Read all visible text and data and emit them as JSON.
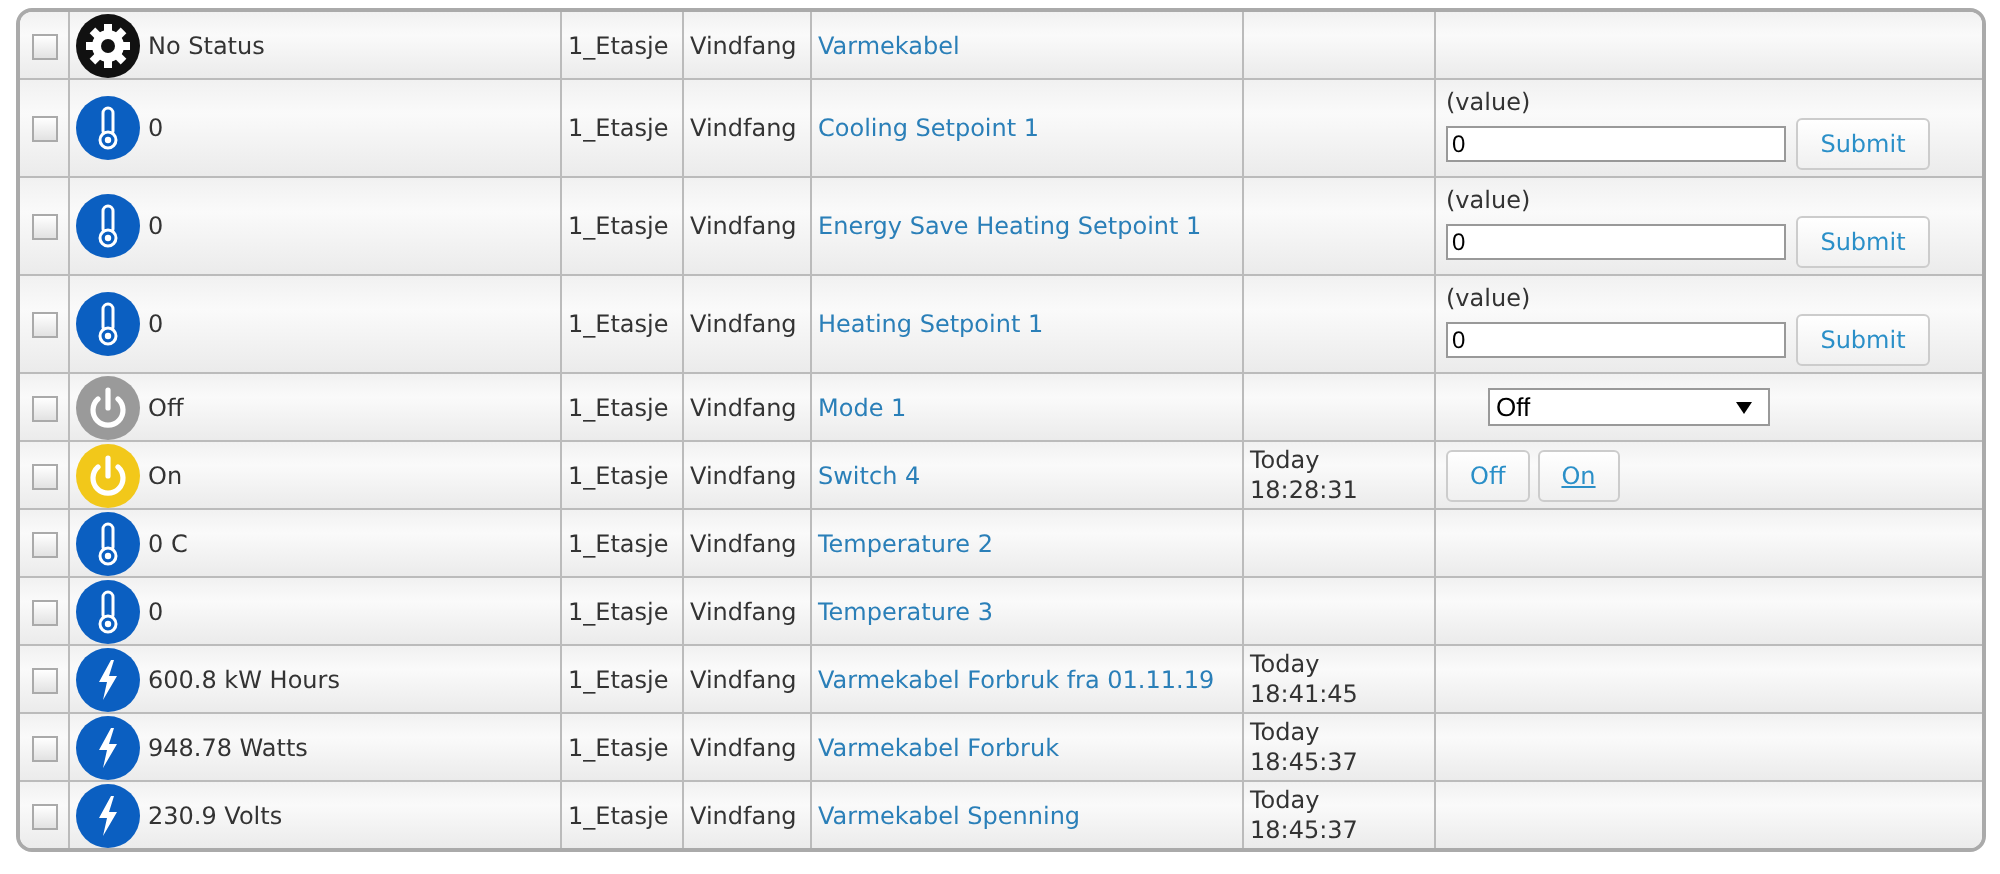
{
  "rows": [
    {
      "checked": false,
      "kind": "gear",
      "status": "No Status",
      "floor": "1_Etasje",
      "room": "Vindfang",
      "name": "Varmekabel",
      "time": [],
      "control": {
        "kind": "none"
      }
    },
    {
      "checked": false,
      "kind": "thermometer",
      "status": "0",
      "floor": "1_Etasje",
      "room": "Vindfang",
      "name": "Cooling Setpoint 1",
      "time": [],
      "control": {
        "kind": "setpoint",
        "label": "(value)",
        "value": "0",
        "button": "Submit"
      }
    },
    {
      "checked": false,
      "kind": "thermometer",
      "status": "0",
      "floor": "1_Etasje",
      "room": "Vindfang",
      "name": "Energy Save Heating Setpoint 1",
      "time": [],
      "control": {
        "kind": "setpoint",
        "label": "(value)",
        "value": "0",
        "button": "Submit"
      }
    },
    {
      "checked": false,
      "kind": "thermometer",
      "status": "0",
      "floor": "1_Etasje",
      "room": "Vindfang",
      "name": "Heating Setpoint 1",
      "time": [],
      "control": {
        "kind": "setpoint",
        "label": "(value)",
        "value": "0",
        "button": "Submit"
      }
    },
    {
      "checked": false,
      "kind": "power",
      "on": false,
      "status": "Off",
      "floor": "1_Etasje",
      "room": "Vindfang",
      "name": "Mode 1",
      "time": [],
      "control": {
        "kind": "select",
        "value": "Off"
      }
    },
    {
      "checked": false,
      "kind": "power",
      "on": true,
      "status": "On",
      "floor": "1_Etasje",
      "room": "Vindfang",
      "name": "Switch 4",
      "time": [
        "Today",
        "18:28:31"
      ],
      "control": {
        "kind": "switch",
        "buttons": [
          {
            "label": "Off",
            "selected": false
          },
          {
            "label": "On",
            "selected": true
          }
        ]
      }
    },
    {
      "checked": false,
      "kind": "thermometer",
      "status": "0 C",
      "floor": "1_Etasje",
      "room": "Vindfang",
      "name": "Temperature 2",
      "time": [],
      "control": {
        "kind": "none"
      }
    },
    {
      "checked": false,
      "kind": "thermometer",
      "status": "0",
      "floor": "1_Etasje",
      "room": "Vindfang",
      "name": "Temperature 3",
      "time": [],
      "control": {
        "kind": "none"
      }
    },
    {
      "checked": false,
      "kind": "meter",
      "status": "600.8 kW Hours",
      "floor": "1_Etasje",
      "room": "Vindfang",
      "name": "Varmekabel Forbruk fra 01.11.19",
      "time": [
        "Today",
        "18:41:45"
      ],
      "control": {
        "kind": "none"
      }
    },
    {
      "checked": false,
      "kind": "meter",
      "status": "948.78 Watts",
      "floor": "1_Etasje",
      "room": "Vindfang",
      "name": "Varmekabel Forbruk",
      "time": [
        "Today",
        "18:45:37"
      ],
      "control": {
        "kind": "none"
      }
    },
    {
      "checked": false,
      "kind": "meter",
      "status": "230.9 Volts",
      "floor": "1_Etasje",
      "room": "Vindfang",
      "name": "Varmekabel Spenning",
      "time": [
        "Today",
        "18:45:37"
      ],
      "control": {
        "kind": "none"
      }
    }
  ]
}
